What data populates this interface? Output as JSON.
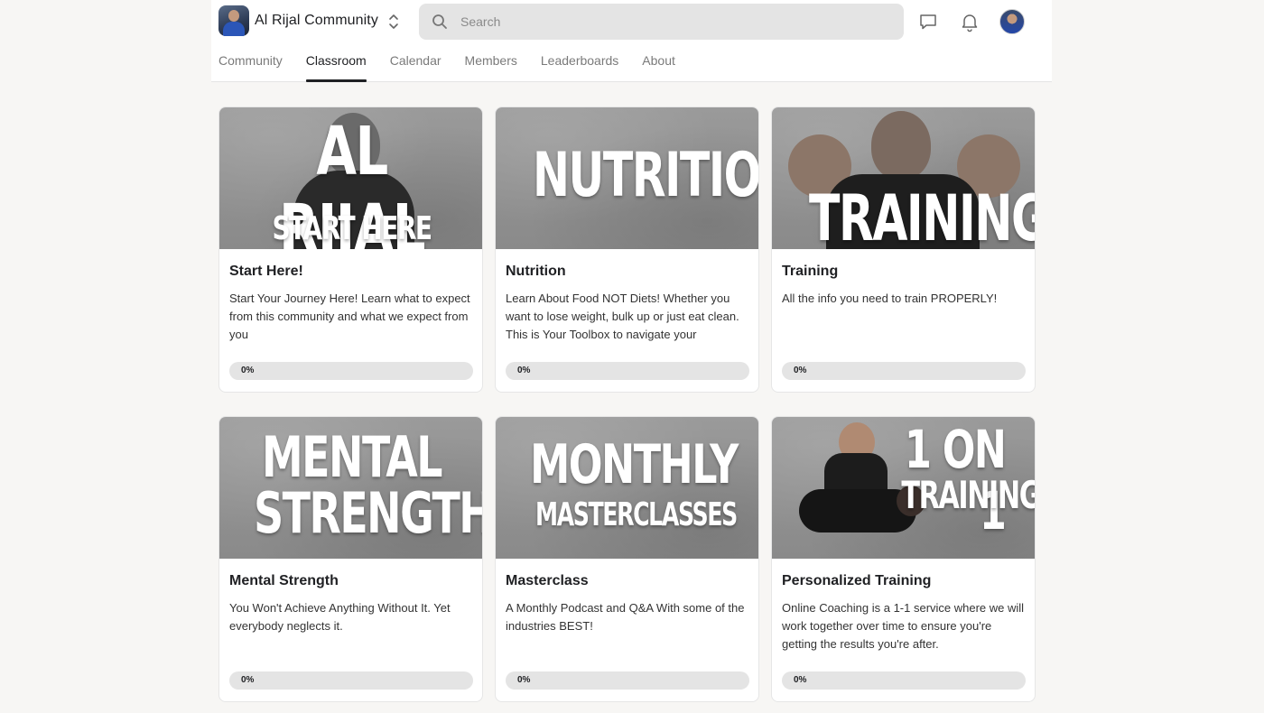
{
  "header": {
    "community_name": "Al Rijal Community",
    "search_placeholder": "Search"
  },
  "tabs": [
    {
      "label": "Community",
      "active": false
    },
    {
      "label": "Classroom",
      "active": true
    },
    {
      "label": "Calendar",
      "active": false
    },
    {
      "label": "Members",
      "active": false
    },
    {
      "label": "Leaderboards",
      "active": false
    },
    {
      "label": "About",
      "active": false
    }
  ],
  "courses": [
    {
      "cover_line1": "AL RIJAL",
      "cover_line2": "START HERE",
      "title": "Start Here!",
      "description": "Start Your Journey Here! Learn what to expect from this community and what we expect from you",
      "progress": 0,
      "progress_label": "0%"
    },
    {
      "cover_line1": "NUTRITION",
      "cover_line2": "",
      "title": "Nutrition",
      "description": "Learn About Food NOT Diets! Whether you want to lose weight, bulk up or just eat clean. This is Your Toolbox to navigate your",
      "progress": 0,
      "progress_label": "0%"
    },
    {
      "cover_line1": "TRAINING",
      "cover_line2": "",
      "title": "Training",
      "description": "All the info you need to train PROPERLY!",
      "progress": 0,
      "progress_label": "0%"
    },
    {
      "cover_line1": "MENTAL",
      "cover_line2": "STRENGTH",
      "title": "Mental Strength",
      "description": "You Won't Achieve Anything Without It. Yet everybody neglects it.",
      "progress": 0,
      "progress_label": "0%"
    },
    {
      "cover_line1": "MONTHLY",
      "cover_line2": "MASTERCLASSES",
      "title": "Masterclass",
      "description": "A Monthly Podcast and Q&A With some of the industries BEST!",
      "progress": 0,
      "progress_label": "0%"
    },
    {
      "cover_line1": "1 ON 1",
      "cover_line2": "TRAINING",
      "title": "Personalized Training",
      "description": "Online Coaching is a 1-1 service where we will work together over time to ensure you're getting the results you're after.",
      "progress": 0,
      "progress_label": "0%"
    }
  ],
  "colors": {
    "progress_fill": "#c9a44b",
    "active_tab": "#202124",
    "page_background": "#f7f6f4"
  }
}
